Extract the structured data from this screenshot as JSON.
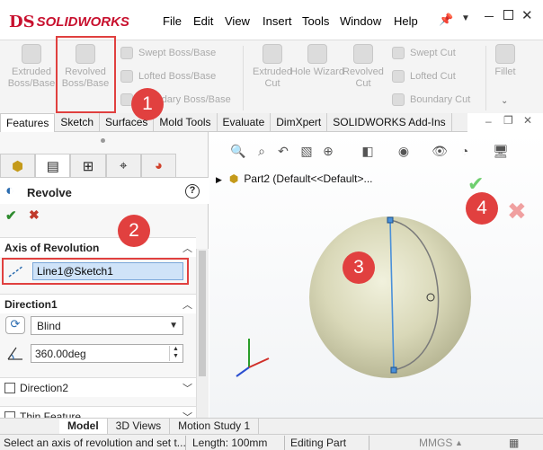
{
  "app": {
    "brand": "SOLIDWORKS",
    "brand_mark": "DS"
  },
  "menu": [
    "File",
    "Edit",
    "View",
    "Insert",
    "Tools",
    "Window",
    "Help"
  ],
  "ribbon": {
    "extruded_boss": "Extruded Boss/Base",
    "revolved_boss": "Revolved Boss/Base",
    "swept_boss": "Swept Boss/Base",
    "lofted_boss": "Lofted Boss/Base",
    "boundary_boss": "Boundary Boss/Base",
    "extruded_cut": "Extruded Cut",
    "hole_wizard": "Hole Wizard",
    "revolved_cut": "Revolved Cut",
    "swept_cut": "Swept Cut",
    "lofted_cut": "Lofted Cut",
    "boundary_cut": "Boundary Cut",
    "fillet": "Fillet"
  },
  "tabs": [
    "Features",
    "Sketch",
    "Surfaces",
    "Mold Tools",
    "Evaluate",
    "DimXpert",
    "SOLIDWORKS Add-Ins"
  ],
  "property_manager": {
    "title": "Revolve",
    "axis_section": "Axis of Revolution",
    "axis_value": "Line1@Sketch1",
    "direction1_section": "Direction1",
    "direction_type": "Blind",
    "angle": "360.00deg",
    "direction2_section": "Direction2",
    "thin_feature_section": "Thin Feature"
  },
  "graphics": {
    "tree_item": "Part2  (Default<<Default>..."
  },
  "bottom_tabs": [
    "Model",
    "3D Views",
    "Motion Study 1"
  ],
  "status": {
    "message": "Select an axis of revolution and set t...",
    "length": "Length: 100mm",
    "mode": "Editing Part",
    "units": "MMGS"
  },
  "callouts": [
    "1",
    "2",
    "3",
    "4"
  ],
  "colors": {
    "callout": "#e1403f",
    "brand": "#c8102e",
    "sphere": "#d9d8b8",
    "axis_line": "#4a90d9"
  }
}
